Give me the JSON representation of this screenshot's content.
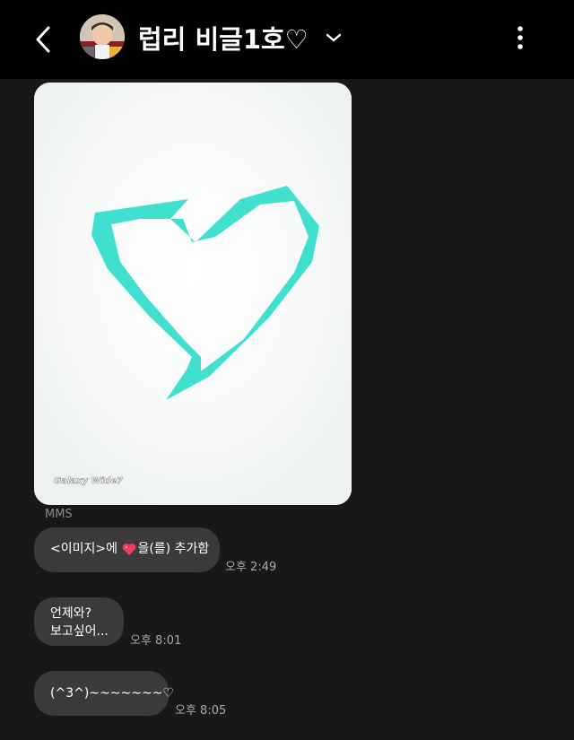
{
  "header": {
    "contact_name": "럽리 비글1호♡",
    "icons": {
      "back": "back-chevron-icon",
      "dropdown": "chevron-down-icon",
      "more": "more-vertical-icon"
    },
    "background": "#000000"
  },
  "attachment": {
    "watermark": "Galaxy Wide7",
    "type_label": "MMS",
    "heart_color": "#40e0d0"
  },
  "messages": [
    {
      "before_emoji": "<이미지>에 ",
      "emoji": "red-heart-emoji",
      "after_emoji": "을(를) 추가함",
      "time": "오후 2:49"
    },
    {
      "lines": [
        "언제와?",
        "보고싶어..."
      ],
      "time": "오후 8:01"
    },
    {
      "text": "(^3^)~~~~~~~♡",
      "time": "오후 8:05"
    }
  ],
  "colors": {
    "background": "#181818",
    "bubble": "#3a3a3a",
    "timestamp": "#a8a8a8"
  }
}
